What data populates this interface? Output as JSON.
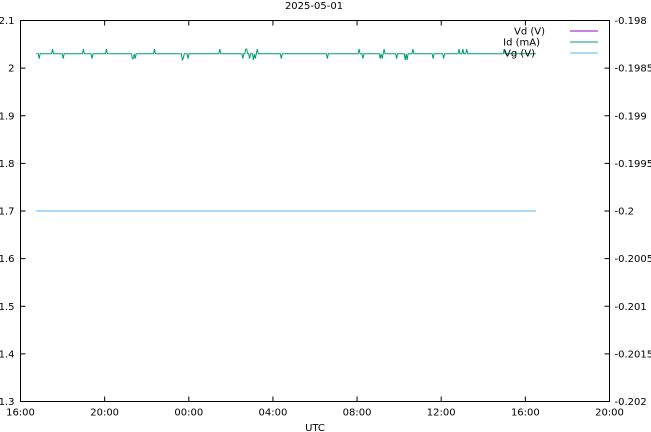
{
  "chart_data": {
    "type": "line",
    "title": "2025-05-01",
    "xlabel": "UTC",
    "ylabel": "",
    "y2label": "",
    "xlim": [
      "16:00",
      "20:00 (+1 day)"
    ],
    "x_ticks": [
      "16:00",
      "20:00",
      "00:00",
      "04:00",
      "08:00",
      "12:00",
      "16:00",
      "20:00"
    ],
    "ylim": [
      1.3,
      2.1
    ],
    "y_ticks": [
      "1.3",
      "1.4",
      "1.5",
      "1.6",
      "1.7",
      "1.8",
      "1.9",
      "2",
      "2.1"
    ],
    "y2lim": [
      -0.202,
      -0.198
    ],
    "y2_ticks": [
      "-0.202",
      "-0.2015",
      "-0.201",
      "-0.2005",
      "-0.2",
      "-0.1995",
      "-0.199",
      "-0.1985",
      "-0.198"
    ],
    "grid": false,
    "legend_position": "top-right",
    "series": [
      {
        "name": "Vd (V)",
        "axis": "y2",
        "color": "#9400d3",
        "visible_in_plot": false,
        "time_range": [
          "16:45",
          "16:30 (+1 day)"
        ],
        "values": []
      },
      {
        "name": "Id (mA)",
        "axis": "y",
        "color": "#009e73",
        "time_range": [
          "16:45",
          "16:30 (+1 day)"
        ],
        "baseline": 2.03,
        "min": 2.02,
        "max": 2.04,
        "values": [
          2.03,
          2.03,
          2.04,
          2.03,
          2.03,
          2.02,
          2.03,
          2.03,
          2.04,
          2.03,
          2.03,
          2.03,
          2.02,
          2.03,
          2.04,
          2.03,
          2.03,
          2.03,
          2.02,
          2.03,
          2.03,
          2.04,
          2.03,
          2.02,
          2.03,
          2.03,
          2.03,
          2.04,
          2.03,
          2.03,
          2.02,
          2.03,
          2.03,
          2.03,
          2.04,
          2.03,
          2.03,
          2.02,
          2.03,
          2.03
        ]
      },
      {
        "name": "Vg (V)",
        "axis": "y2",
        "color": "#56b4e9",
        "time_range": [
          "16:45",
          "16:30 (+1 day)"
        ],
        "values": [
          -0.2,
          -0.2
        ]
      }
    ]
  }
}
